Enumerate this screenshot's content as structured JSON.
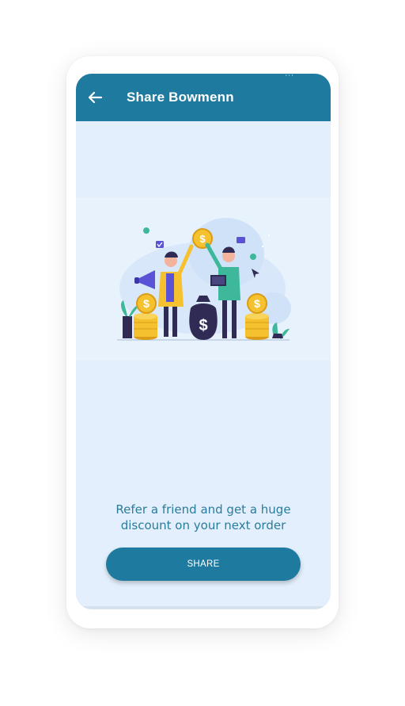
{
  "status_bar": {
    "indicator": "···"
  },
  "app_bar": {
    "title": "Share Bowmenn",
    "back_icon": "arrow-left-icon"
  },
  "illustration": {
    "description_icon": "referral-illustration",
    "coin_symbol": "$"
  },
  "promo": {
    "line1": "Refer a friend and get a huge",
    "line2": "discount on your next order"
  },
  "share_button": {
    "label": "SHARE"
  },
  "colors": {
    "primary": "#1e7a9f",
    "screen_bg": "#e3effc",
    "promo_text": "#2a7c9c",
    "coin": "#f5c12e"
  }
}
